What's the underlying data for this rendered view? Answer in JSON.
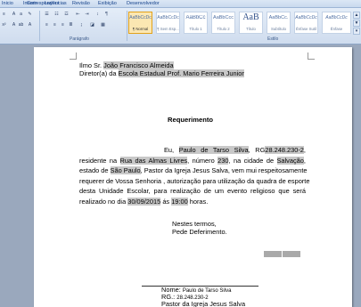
{
  "ribbon": {
    "tabs": [
      "Inicio",
      "Inserir",
      "Layout",
      "Correspondências",
      "Revisão",
      "Exibição",
      "Desenvolvedor"
    ],
    "groups": {
      "paragraph": "Parágrafo",
      "styles": "Estilo"
    },
    "styles": [
      {
        "sample": "AaBbCcDc",
        "name": "¶ Normal",
        "selected": true
      },
      {
        "sample": "AaBbCcDc",
        "name": "¶ Sem Esp...",
        "selected": false
      },
      {
        "sample": "AaBbCc",
        "name": "Título 1",
        "selected": false
      },
      {
        "sample": "AaBbCcc",
        "name": "Título 2",
        "selected": false
      },
      {
        "sample": "AaB",
        "name": "Título",
        "selected": false
      },
      {
        "sample": "AaBbCc.",
        "name": "Subtítulo",
        "selected": false
      },
      {
        "sample": "AaBbCcDc",
        "name": "Ênfase Sutil",
        "selected": false
      },
      {
        "sample": "AaBbCcDc",
        "name": "Ênfase",
        "selected": false
      }
    ],
    "colors": {
      "accent": "#e3a21a",
      "ribbon": "#dbe7f5",
      "workspace": "#9aa8bd"
    }
  },
  "document": {
    "header": {
      "line1_prefix": "Ilmo Sr.",
      "recipient_name": "João Francisco Almeida",
      "line2_prefix": "Diretor(a) da",
      "school": "Escola Estadual  Prof. Mario Ferreira Junior"
    },
    "title": "Requerimento",
    "body": {
      "l1_a": "Eu,",
      "name": "Paulo de Tarso Silva",
      "l1_b": ", RG",
      "rg": "28.248.230-2",
      "l1_c": ",",
      "l2_a": "residente na",
      "street": "Rua das Almas Livres",
      "l2_b": ", número",
      "number": "230",
      "l2_c": ", na cidade de",
      "city": "Salvação",
      "l2_d": ",",
      "l3_a": "estado de",
      "state": "São Paulo",
      "l3_b": ", Pastor da Igreja Jesus Salva, vem mui respeitosamente",
      "l4": "requerer de Vossa Senhoria , autorização para utilização da quadra de esporte",
      "l5": "desta Unidade Escolar, para realização de um evento religioso que será",
      "l6_a": "realizado no dia",
      "date": "30/09/2015",
      "l6_b": "ás",
      "time": "19:00",
      "l6_c": "horas."
    },
    "closing": {
      "line1": "Nestes termos,",
      "line2": "Pede Deferimento."
    },
    "signature": {
      "name_label": "Nome:",
      "name_value": "Paulo de Tarso Silva",
      "rg_label": "RG.:",
      "rg_value": "28.248.230-2",
      "role": "Pastor da Igreja Jesus Salva"
    }
  }
}
